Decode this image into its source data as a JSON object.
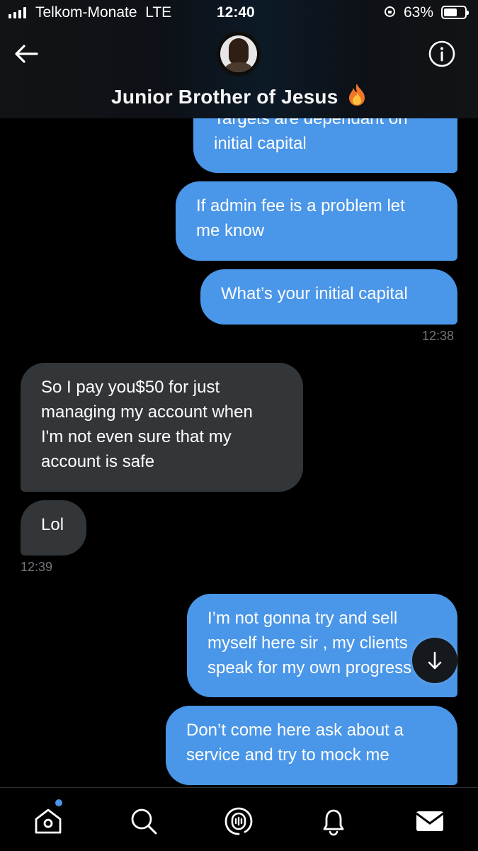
{
  "status_bar": {
    "carrier": "Telkom-Monate",
    "network": "LTE",
    "time": "12:40",
    "battery_percent": "63%",
    "battery_level": 0.63,
    "signal_bars": 4
  },
  "header": {
    "name": "Junior Brother of Jesus",
    "name_emoji": "🔥",
    "back_icon": "arrow-left-icon",
    "info_icon": "info-icon"
  },
  "messages": [
    {
      "side": "out",
      "text": "Targets are dependant on initial capital"
    },
    {
      "side": "out",
      "text": "If admin fee is a problem let me know"
    },
    {
      "side": "out",
      "text": "What’s your initial capital"
    },
    {
      "timestamp": "12:38"
    },
    {
      "side": "in",
      "text": "So I pay you$50 for just managing my account when I'm not even sure that my account is safe"
    },
    {
      "side": "in",
      "text": "Lol"
    },
    {
      "timestamp": "12:39"
    },
    {
      "side": "out",
      "text": "I’m not gonna try and sell myself here sir , my clients speak for my own progress"
    },
    {
      "side": "out",
      "text": "Don’t come here ask about a service and try to mock me"
    }
  ],
  "colors": {
    "outgoing_bubble": "#4a96e8",
    "incoming_bubble": "#333639",
    "timestamp": "#71767b",
    "background": "#000000"
  },
  "tab_bar": {
    "items": [
      {
        "icon": "home-icon",
        "has_notification_dot": true
      },
      {
        "icon": "search-icon"
      },
      {
        "icon": "spaces-icon"
      },
      {
        "icon": "bell-icon"
      },
      {
        "icon": "mail-icon"
      }
    ]
  },
  "scroll_down_icon": "arrow-down-icon"
}
